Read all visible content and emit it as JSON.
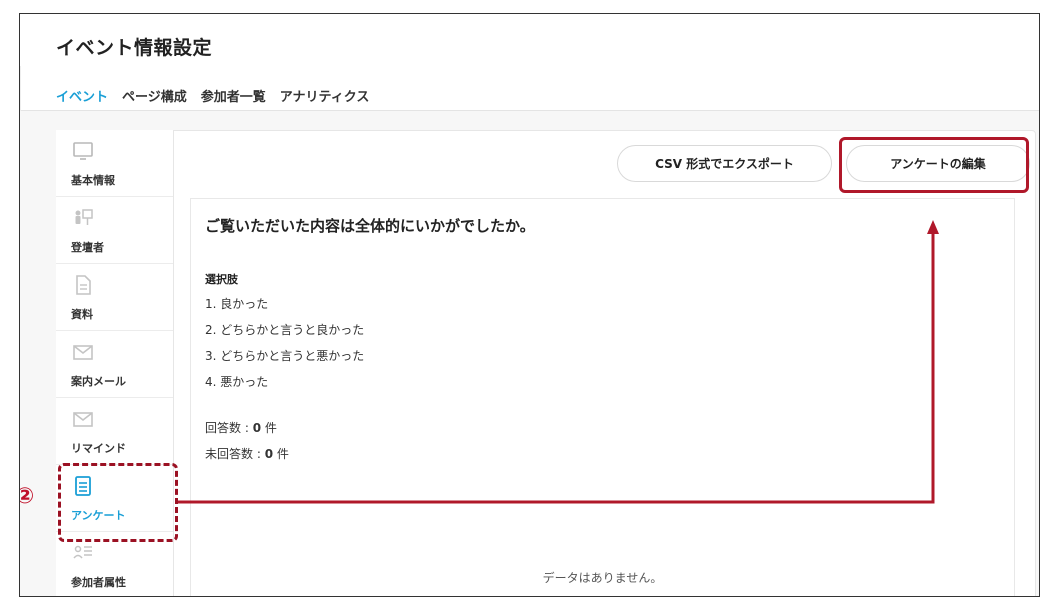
{
  "header": {
    "title": "イベント情報設定"
  },
  "tabs": [
    {
      "label": "イベント",
      "active": true
    },
    {
      "label": "ページ構成",
      "active": false
    },
    {
      "label": "参加者一覧",
      "active": false
    },
    {
      "label": "アナリティクス",
      "active": false
    }
  ],
  "sidebar": {
    "items": [
      {
        "label": "基本情報",
        "icon": "monitor-icon"
      },
      {
        "label": "登壇者",
        "icon": "presenter-icon"
      },
      {
        "label": "資料",
        "icon": "document-icon"
      },
      {
        "label": "案内メール",
        "icon": "mail-icon"
      },
      {
        "label": "リマインド",
        "icon": "mail-icon"
      },
      {
        "label": "アンケート",
        "icon": "survey-icon",
        "active": true
      },
      {
        "label": "参加者属性",
        "icon": "user-list-icon"
      }
    ]
  },
  "toolbar": {
    "csv_label": "CSV 形式でエクスポート",
    "edit_label": "アンケートの編集"
  },
  "question": {
    "title": "ご覧いただいた内容は全体的にいかがでしたか。",
    "choices_heading": "選択肢",
    "choices": [
      "1. 良かった",
      "2. どちらかと言うと良かった",
      "3. どちらかと言うと悪かった",
      "4. 悪かった"
    ],
    "answered_label": "回答数 : ",
    "answered_value": "0",
    "unanswered_label": "未回答数 : ",
    "unanswered_value": "0",
    "unit": " 件",
    "empty_message": "データはありません。"
  },
  "annotation": {
    "step_marker": "②",
    "color": "#b0182a"
  },
  "colors": {
    "accent": "#1a9fd6",
    "highlight": "#b0182a"
  }
}
